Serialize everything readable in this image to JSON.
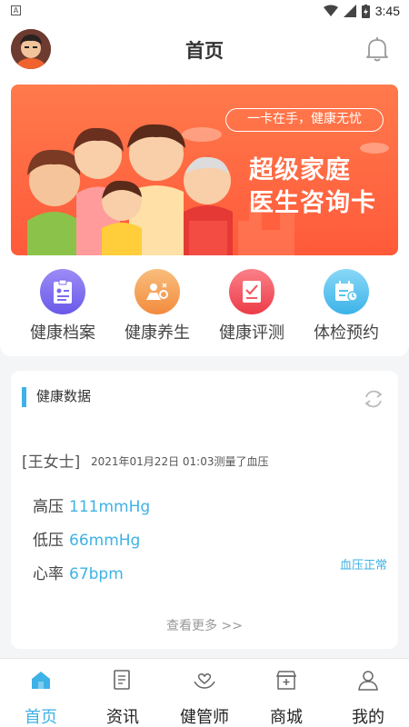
{
  "status_bar": {
    "time": "3:45",
    "notif_icon": "A"
  },
  "header": {
    "title": "首页"
  },
  "banner": {
    "slogan": "一卡在手，健康无忧",
    "title_line1": "超级家庭",
    "title_line2": "医生咨询卡"
  },
  "categories": [
    {
      "label": "健康档案",
      "color": "#7b6cf0"
    },
    {
      "label": "健康养生",
      "color": "#f6a05a"
    },
    {
      "label": "健康评测",
      "color": "#f25d64"
    },
    {
      "label": "体检预约",
      "color": "#5ac4f0"
    }
  ],
  "health_data": {
    "title": "健康数据",
    "user": "[王女士]",
    "record": "2021年01月22日  01:03测量了血压",
    "rows": [
      {
        "key": "高压",
        "value": "111mmHg"
      },
      {
        "key": "低压",
        "value": "66mmHg"
      },
      {
        "key": "心率",
        "value": "67bpm"
      }
    ],
    "status": "血压正常",
    "more": "查看更多 >>"
  },
  "tabs": [
    {
      "label": "首页",
      "icon": "home-icon",
      "active": true
    },
    {
      "label": "资讯",
      "icon": "news-icon",
      "active": false
    },
    {
      "label": "健管师",
      "icon": "care-icon",
      "active": false
    },
    {
      "label": "商城",
      "icon": "shop-icon",
      "active": false
    },
    {
      "label": "我的",
      "icon": "profile-icon",
      "active": false
    }
  ],
  "colors": {
    "accent": "#3eb2e6",
    "banner": "#ff5a3a"
  }
}
